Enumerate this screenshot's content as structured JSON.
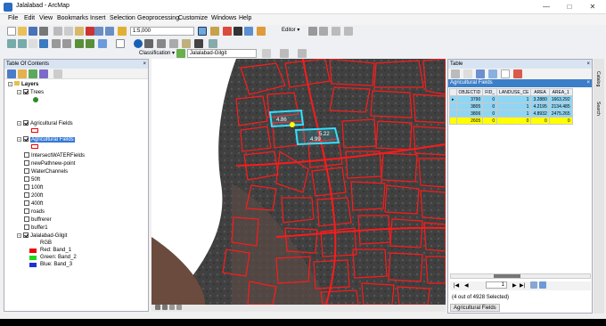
{
  "window": {
    "title": "Jalalabad - ArcMap"
  },
  "menu": [
    "File",
    "Edit",
    "View",
    "Bookmarks",
    "Insert",
    "Selection",
    "Geoprocessing",
    "Customize",
    "Windows",
    "Help"
  ],
  "toolbar": {
    "scale": "1:5,000",
    "editor_label": "Editor ▾",
    "classification_label": "Classification ▾",
    "layer_combo": "Jalalabad-Gilgit"
  },
  "toc": {
    "title": "Table Of Contents",
    "root": "Layers",
    "items": [
      "Trees",
      "Agricultural Fields",
      "Agricultural Fields",
      "IntersectWATERFields",
      "newPathnew-point",
      "WaterChannels",
      "50ft",
      "100ft",
      "200ft",
      "400ft",
      "roads",
      "buffrerer",
      "buffer1",
      "Jalalabad-Gilgit",
      "RGB",
      "Red:   Band_1",
      "Green: Band_2",
      "Blue:   Band_3"
    ]
  },
  "table": {
    "title": "Table",
    "layer": "Agricultural Fields",
    "columns": [
      "OBJECTID",
      "FID_",
      "LANDUSE_CE",
      "AREA",
      "AREA_1"
    ],
    "rows": [
      [
        "3790",
        "0",
        "1",
        "3.2880",
        "1663.292"
      ],
      [
        "3805",
        "0",
        "1",
        "4.2195",
        "2134.485"
      ],
      [
        "3806",
        "0",
        "1",
        "4.8932",
        "2475.265"
      ],
      [
        "2605",
        "0",
        "0",
        "0",
        "0"
      ]
    ],
    "page": "1",
    "selection_info": "(4 out of 4928 Selected)",
    "tab_label": "Agricultural Fields"
  },
  "map": {
    "label_a": "4.99",
    "label_b": "5.22",
    "label_c": "4.86"
  },
  "side_tabs": [
    "Catalog",
    "Search"
  ],
  "colors": {
    "field_outline": "#ff1a1a",
    "selection": "#33e0ff",
    "table_header": "#3c7fc9"
  }
}
